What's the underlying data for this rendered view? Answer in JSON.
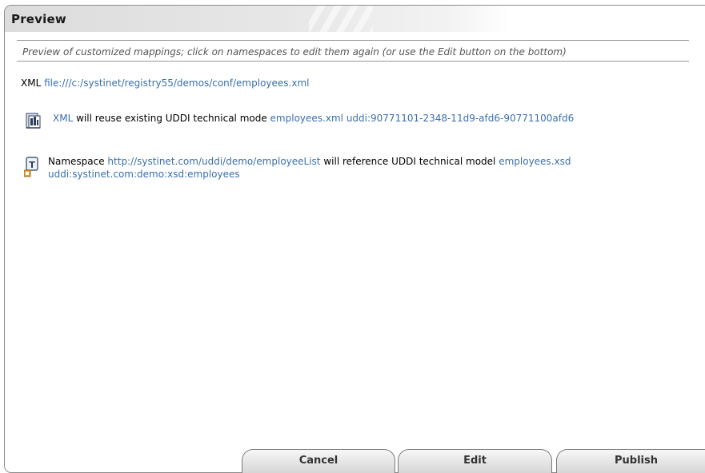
{
  "panel": {
    "title": "Preview",
    "subtitle": "Preview of customized mappings; click on namespaces to edit them again (or use the Edit button on the bottom)"
  },
  "xml_line": {
    "label": "XML",
    "url": "file:///c:/systinet/registry55/demos/conf/employees.xml"
  },
  "rows": [
    {
      "icon": "xml-document-icon",
      "link_text": "XML",
      "text": " will reuse existing UDDI technical mode ",
      "model_name": "employees.xml",
      "model_key": "uddi:90771101-2348-11d9-afd6-90771100afd6"
    },
    {
      "icon": "xsd-namespace-icon",
      "prefix": "Namespace ",
      "namespace": "http://systinet.com/uddi/demo/employeeList",
      "text": " will reference UDDI technical model ",
      "model_name": "employees.xsd",
      "model_key": "uddi:systinet.com:demo:xsd:employees"
    }
  ],
  "buttons": {
    "cancel": "Cancel",
    "edit": "Edit",
    "publish": "Publish"
  },
  "colors": {
    "link": "#3a6fb0",
    "border": "#8c8c8c",
    "rule": "#999999"
  }
}
